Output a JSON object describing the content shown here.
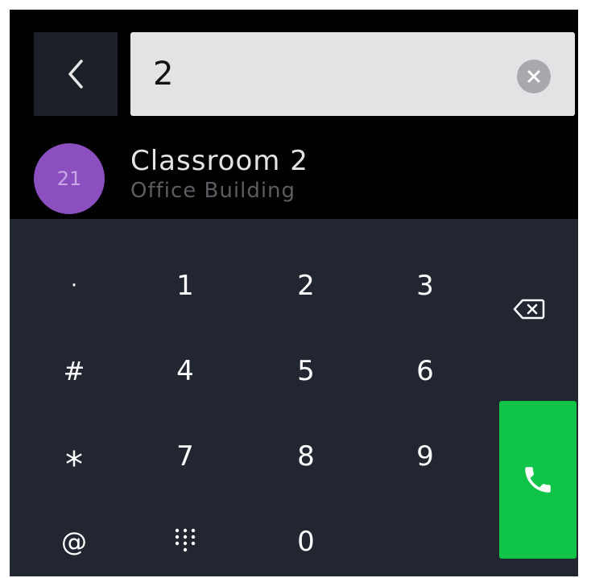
{
  "search": {
    "value": "2",
    "back_icon": "chevron-left-icon",
    "clear_icon": "clear-circle-icon"
  },
  "results": [
    {
      "avatar_text": "21",
      "name": "Classroom 2",
      "subtitle": "Office Building",
      "avatar_color": "#8b4fc0"
    }
  ],
  "keypad": {
    "keys": [
      {
        "label": "·",
        "name": "key-dot"
      },
      {
        "label": "1",
        "name": "key-1"
      },
      {
        "label": "2",
        "name": "key-2"
      },
      {
        "label": "3",
        "name": "key-3"
      },
      {
        "label": "#",
        "name": "key-hash"
      },
      {
        "label": "4",
        "name": "key-4"
      },
      {
        "label": "5",
        "name": "key-5"
      },
      {
        "label": "6",
        "name": "key-6"
      },
      {
        "label": "*",
        "name": "key-star"
      },
      {
        "label": "7",
        "name": "key-7"
      },
      {
        "label": "8",
        "name": "key-8"
      },
      {
        "label": "9",
        "name": "key-9"
      },
      {
        "label": "@",
        "name": "key-at"
      },
      {
        "label": "",
        "name": "key-dialpad-toggle",
        "icon": "dialpad-grid-icon"
      },
      {
        "label": "0",
        "name": "key-0"
      }
    ],
    "backspace_icon": "backspace-icon",
    "call_icon": "phone-icon",
    "call_color": "#0fc447"
  },
  "colors": {
    "background": "#000000",
    "keypad_background": "#212631",
    "search_background": "#e2e3e5",
    "accent_green": "#0fc447"
  }
}
